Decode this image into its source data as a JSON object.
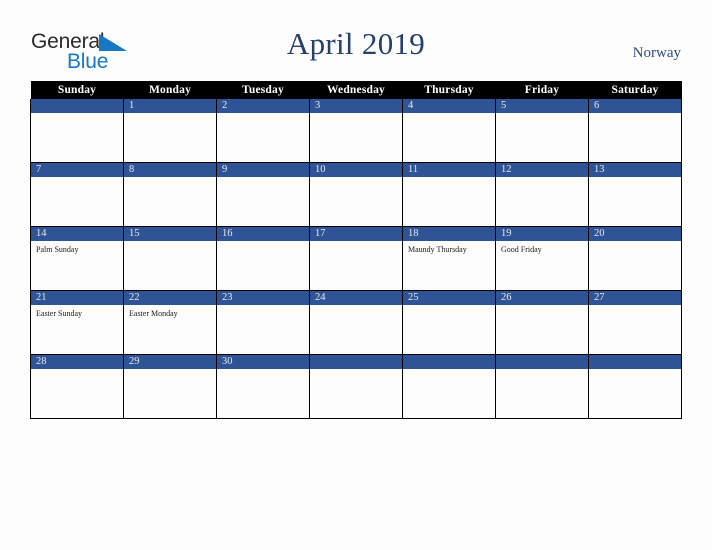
{
  "brand": {
    "name_part1": "General",
    "name_part2": "Blue",
    "triangle_icon": "blue-triangle-icon",
    "triangle_color": "#1778c6"
  },
  "header": {
    "title": "April 2019",
    "country": "Norway"
  },
  "colors": {
    "header_row_bg": "#000000",
    "day_bar_bg": "#2f5496",
    "day_number": "#e8e8ec",
    "title_text": "#26406e",
    "page_bg": "#fdfdfd",
    "grid_line": "#000000"
  },
  "calendar": {
    "weekday_headers": [
      "Sunday",
      "Monday",
      "Tuesday",
      "Wednesday",
      "Thursday",
      "Friday",
      "Saturday"
    ],
    "weeks": [
      [
        {
          "day": "",
          "events": []
        },
        {
          "day": "1",
          "events": []
        },
        {
          "day": "2",
          "events": []
        },
        {
          "day": "3",
          "events": []
        },
        {
          "day": "4",
          "events": []
        },
        {
          "day": "5",
          "events": []
        },
        {
          "day": "6",
          "events": []
        }
      ],
      [
        {
          "day": "7",
          "events": []
        },
        {
          "day": "8",
          "events": []
        },
        {
          "day": "9",
          "events": []
        },
        {
          "day": "10",
          "events": []
        },
        {
          "day": "11",
          "events": []
        },
        {
          "day": "12",
          "events": []
        },
        {
          "day": "13",
          "events": []
        }
      ],
      [
        {
          "day": "14",
          "events": [
            "Palm Sunday"
          ]
        },
        {
          "day": "15",
          "events": []
        },
        {
          "day": "16",
          "events": []
        },
        {
          "day": "17",
          "events": []
        },
        {
          "day": "18",
          "events": [
            "Maundy Thursday"
          ]
        },
        {
          "day": "19",
          "events": [
            "Good Friday"
          ]
        },
        {
          "day": "20",
          "events": []
        }
      ],
      [
        {
          "day": "21",
          "events": [
            "Easter Sunday"
          ]
        },
        {
          "day": "22",
          "events": [
            "Easter Monday"
          ]
        },
        {
          "day": "23",
          "events": []
        },
        {
          "day": "24",
          "events": []
        },
        {
          "day": "25",
          "events": []
        },
        {
          "day": "26",
          "events": []
        },
        {
          "day": "27",
          "events": []
        }
      ],
      [
        {
          "day": "28",
          "events": []
        },
        {
          "day": "29",
          "events": []
        },
        {
          "day": "30",
          "events": []
        },
        {
          "day": "",
          "events": []
        },
        {
          "day": "",
          "events": []
        },
        {
          "day": "",
          "events": []
        },
        {
          "day": "",
          "events": []
        }
      ]
    ]
  }
}
